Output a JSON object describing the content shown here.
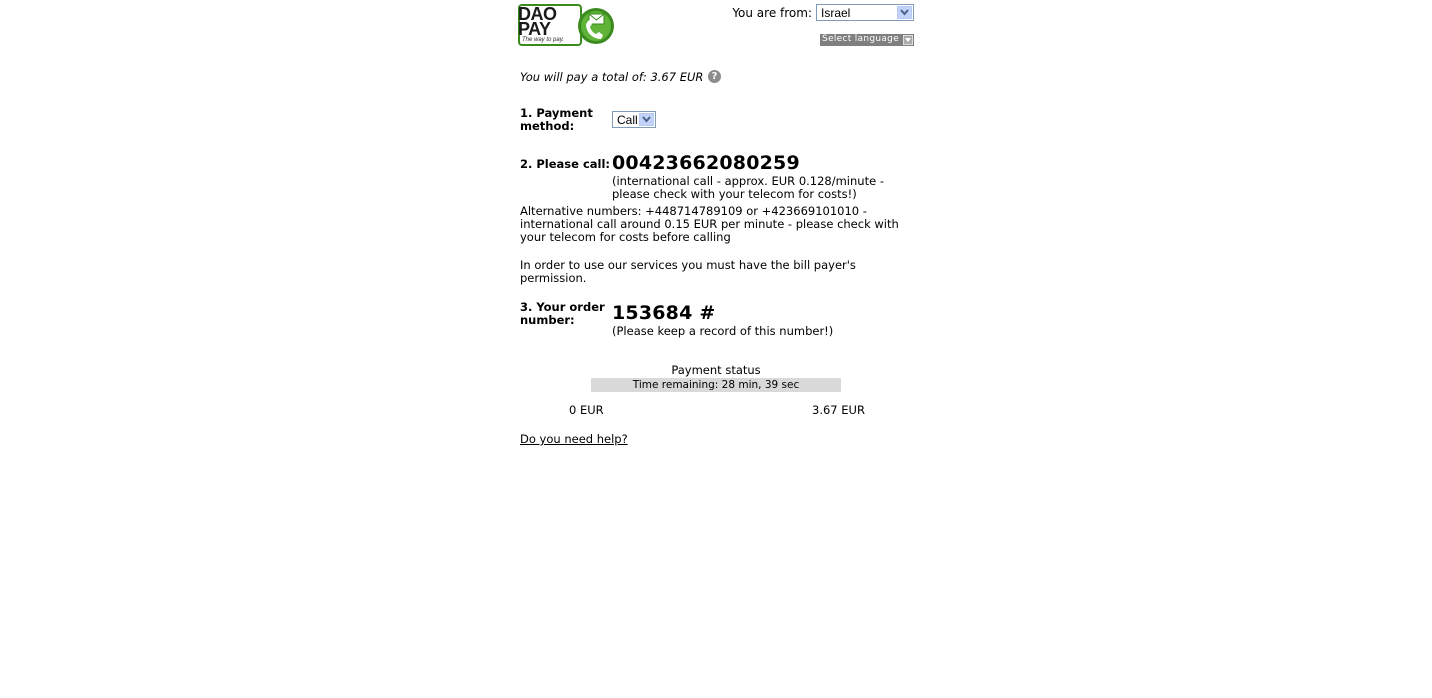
{
  "header": {
    "logo": {
      "line1": "DAO",
      "line2": "PAY",
      "tagline": "The way to pay."
    },
    "from_label": "You are from:",
    "country_value": "Israel",
    "language_value": "Select language"
  },
  "total_text": "You will pay a total of: 3.67 EUR",
  "help_icon_glyph": "?",
  "steps": {
    "payment_method": {
      "label": "1. Payment method:",
      "value": "Call"
    },
    "please_call": {
      "label": "2. Please call:",
      "number": "00423662080259",
      "note": "(international call - approx. EUR 0.128/minute - please check with your telecom for costs!)"
    },
    "alternative": "Alternative numbers: +448714789109 or +423669101010 - international call around 0.15 EUR per minute - please check with your telecom for costs before calling",
    "permission": "In order to use our services you must have the bill payer's permission.",
    "order": {
      "label": "3. Your order number:",
      "number": "153684 #",
      "note": "(Please keep a record of this number!)"
    }
  },
  "status": {
    "title": "Payment status",
    "time_remaining": "Time remaining: 28 min, 39 sec",
    "progress_fraction": 0,
    "min_label": "0 EUR",
    "max_label": "3.67 EUR"
  },
  "help_link": "Do you need help?",
  "icons": {
    "logo_badge": "phone-envelope-icon",
    "dropdown": "chevron-down-icon",
    "help": "question-circle-icon"
  },
  "colors": {
    "brand_green": "#3a8a1e",
    "select_border": "#7f9db9",
    "bar_bg": "#d9d9d9"
  }
}
